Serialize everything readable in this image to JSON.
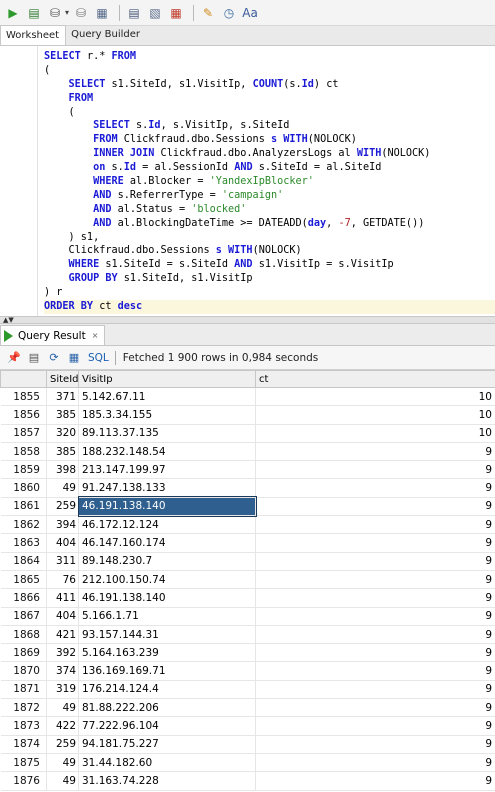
{
  "toolbar": {
    "buttons": [
      {
        "name": "run-statement-icon",
        "glyph": "▶",
        "color": "#2e9a2e"
      },
      {
        "name": "run-script-icon",
        "glyph": "▤",
        "color": "#2e7a2e"
      },
      {
        "name": "commit-icon",
        "glyph": "⛁",
        "color": "#555555"
      },
      {
        "name": "rollback-icon",
        "glyph": "⛁",
        "color": "#777777"
      },
      {
        "name": "explain-plan-icon",
        "glyph": "▦",
        "color": "#566a8a"
      },
      {
        "name": "autotrace-icon",
        "glyph": "▤",
        "color": "#4a5a7a"
      },
      {
        "name": "sql-tuning-icon",
        "glyph": "▧",
        "color": "#5a6a8a"
      },
      {
        "name": "format-icon",
        "glyph": "▦",
        "color": "#c0392b"
      },
      {
        "name": "clear-icon",
        "glyph": "✎",
        "color": "#d08a1a"
      },
      {
        "name": "history-icon",
        "glyph": "◷",
        "color": "#3a6aa0"
      },
      {
        "name": "case-icon",
        "glyph": "Aa",
        "color": "#3a5a9a"
      }
    ]
  },
  "worksheet_tabs": [
    "Worksheet",
    "Query Builder"
  ],
  "editor": {
    "lines": [
      [
        [
          "kw",
          "SELECT"
        ],
        [
          "p",
          " r.* "
        ],
        [
          "kw",
          "FROM"
        ]
      ],
      [
        [
          "p",
          "("
        ]
      ],
      [
        [
          "p",
          "    "
        ],
        [
          "kw",
          "SELECT"
        ],
        [
          "p",
          " s1.SiteId, s1.VisitIp, "
        ],
        [
          "kw",
          "COUNT"
        ],
        [
          "p",
          "(s."
        ],
        [
          "kw",
          "Id"
        ],
        [
          "p",
          ") ct"
        ]
      ],
      [
        [
          "p",
          "    "
        ],
        [
          "kw",
          "FROM"
        ]
      ],
      [
        [
          "p",
          "    ("
        ]
      ],
      [
        [
          "p",
          "        "
        ],
        [
          "kw",
          "SELECT"
        ],
        [
          "p",
          " s."
        ],
        [
          "kw",
          "Id"
        ],
        [
          "p",
          ", s.VisitIp, s.SiteId"
        ]
      ],
      [
        [
          "p",
          "        "
        ],
        [
          "kw",
          "FROM"
        ],
        [
          "p",
          " Clickfraud.dbo.Sessions "
        ],
        [
          "kw",
          "s"
        ],
        [
          "p",
          " "
        ],
        [
          "kw",
          "WITH"
        ],
        [
          "p",
          "(NOLOCK)"
        ]
      ],
      [
        [
          "p",
          "        "
        ],
        [
          "kw",
          "INNER JOIN"
        ],
        [
          "p",
          " Clickfraud.dbo.AnalyzersLogs al "
        ],
        [
          "kw",
          "WITH"
        ],
        [
          "p",
          "(NOLOCK)"
        ]
      ],
      [
        [
          "p",
          "        "
        ],
        [
          "kw",
          "on"
        ],
        [
          "p",
          " s."
        ],
        [
          "kw",
          "Id"
        ],
        [
          "p",
          " = al.SessionId "
        ],
        [
          "kw",
          "AND"
        ],
        [
          "p",
          " s.SiteId = al.SiteId"
        ]
      ],
      [
        [
          "p",
          "        "
        ],
        [
          "kw",
          "WHERE"
        ],
        [
          "p",
          " al.Blocker = "
        ],
        [
          "str",
          "'YandexIpBlocker'"
        ]
      ],
      [
        [
          "p",
          "        "
        ],
        [
          "kw",
          "AND"
        ],
        [
          "p",
          " s.ReferrerType = "
        ],
        [
          "str",
          "'campaign'"
        ]
      ],
      [
        [
          "p",
          "        "
        ],
        [
          "kw",
          "AND"
        ],
        [
          "p",
          " al.Status = "
        ],
        [
          "str",
          "'blocked'"
        ]
      ],
      [
        [
          "p",
          "        "
        ],
        [
          "kw",
          "AND"
        ],
        [
          "p",
          " al.BlockingDateTime >= DATEADD("
        ],
        [
          "kw",
          "day"
        ],
        [
          "p",
          ", "
        ],
        [
          "num",
          "-7"
        ],
        [
          "p",
          ", GETDATE())"
        ]
      ],
      [
        [
          "p",
          "    ) s1,"
        ]
      ],
      [
        [
          "p",
          "    Clickfraud.dbo.Sessions "
        ],
        [
          "kw",
          "s"
        ],
        [
          "p",
          " "
        ],
        [
          "kw",
          "WITH"
        ],
        [
          "p",
          "(NOLOCK)"
        ]
      ],
      [
        [
          "p",
          "    "
        ],
        [
          "kw",
          "WHERE"
        ],
        [
          "p",
          " s1.SiteId = s.SiteId "
        ],
        [
          "kw",
          "AND"
        ],
        [
          "p",
          " s1.VisitIp = s.VisitIp"
        ]
      ],
      [
        [
          "p",
          "    "
        ],
        [
          "kw",
          "GROUP BY"
        ],
        [
          "p",
          " s1.SiteId, s1.VisitIp"
        ]
      ],
      [
        [
          "p",
          ") r"
        ]
      ],
      [
        [
          "kw",
          "ORDER BY"
        ],
        [
          "p",
          " ct "
        ],
        [
          "kw",
          "desc"
        ]
      ]
    ]
  },
  "result": {
    "tab_label": "Query Result",
    "close_glyph": "×",
    "sql_link": "SQL",
    "fetched_text": "Fetched 1 900 rows in 0,984 seconds",
    "columns": [
      "",
      "SiteId",
      "VisitIp",
      "ct"
    ],
    "rows": [
      [
        "1855",
        "371",
        "5.142.67.11",
        "10"
      ],
      [
        "1856",
        "385",
        "185.3.34.155",
        "10"
      ],
      [
        "1857",
        "320",
        "89.113.37.135",
        "10"
      ],
      [
        "1858",
        "385",
        "188.232.148.54",
        "9"
      ],
      [
        "1859",
        "398",
        "213.147.199.97",
        "9"
      ],
      [
        "1860",
        "49",
        "91.247.138.133",
        "9"
      ],
      [
        "1861",
        "259",
        "46.191.138.140",
        "9"
      ],
      [
        "1862",
        "394",
        "46.172.12.124",
        "9"
      ],
      [
        "1863",
        "404",
        "46.147.160.174",
        "9"
      ],
      [
        "1864",
        "311",
        "89.148.230.7",
        "9"
      ],
      [
        "1865",
        "76",
        "212.100.150.74",
        "9"
      ],
      [
        "1866",
        "411",
        "46.191.138.140",
        "9"
      ],
      [
        "1867",
        "404",
        "5.166.1.71",
        "9"
      ],
      [
        "1868",
        "421",
        "93.157.144.31",
        "9"
      ],
      [
        "1869",
        "392",
        "5.164.163.239",
        "9"
      ],
      [
        "1870",
        "374",
        "136.169.169.71",
        "9"
      ],
      [
        "1871",
        "319",
        "176.214.124.4",
        "9"
      ],
      [
        "1872",
        "49",
        "81.88.222.206",
        "9"
      ],
      [
        "1873",
        "422",
        "77.222.96.104",
        "9"
      ],
      [
        "1874",
        "259",
        "94.181.75.227",
        "9"
      ],
      [
        "1875",
        "49",
        "31.44.182.60",
        "9"
      ],
      [
        "1876",
        "49",
        "31.163.74.228",
        "9"
      ]
    ],
    "selected_row": 6
  }
}
